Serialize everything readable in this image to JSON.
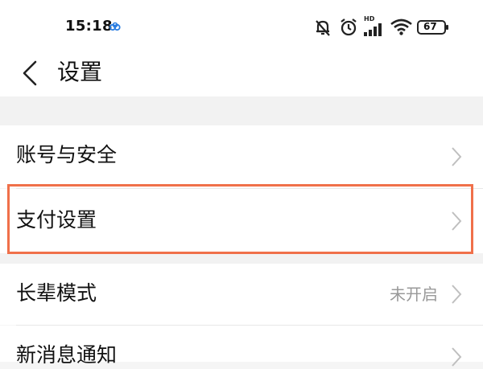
{
  "status_bar": {
    "time": "15:18",
    "battery": "67",
    "network_badge": "HD"
  },
  "header": {
    "title": "设置"
  },
  "settings": {
    "items": [
      {
        "label": "账号与安全",
        "value": ""
      },
      {
        "label": "支付设置",
        "value": ""
      },
      {
        "label": "长辈模式",
        "value": "未开启"
      },
      {
        "label": "新消息通知",
        "value": ""
      }
    ]
  },
  "colors": {
    "highlight": "#f0704a",
    "value_text": "#999999",
    "chevron": "#bfbfbf"
  }
}
